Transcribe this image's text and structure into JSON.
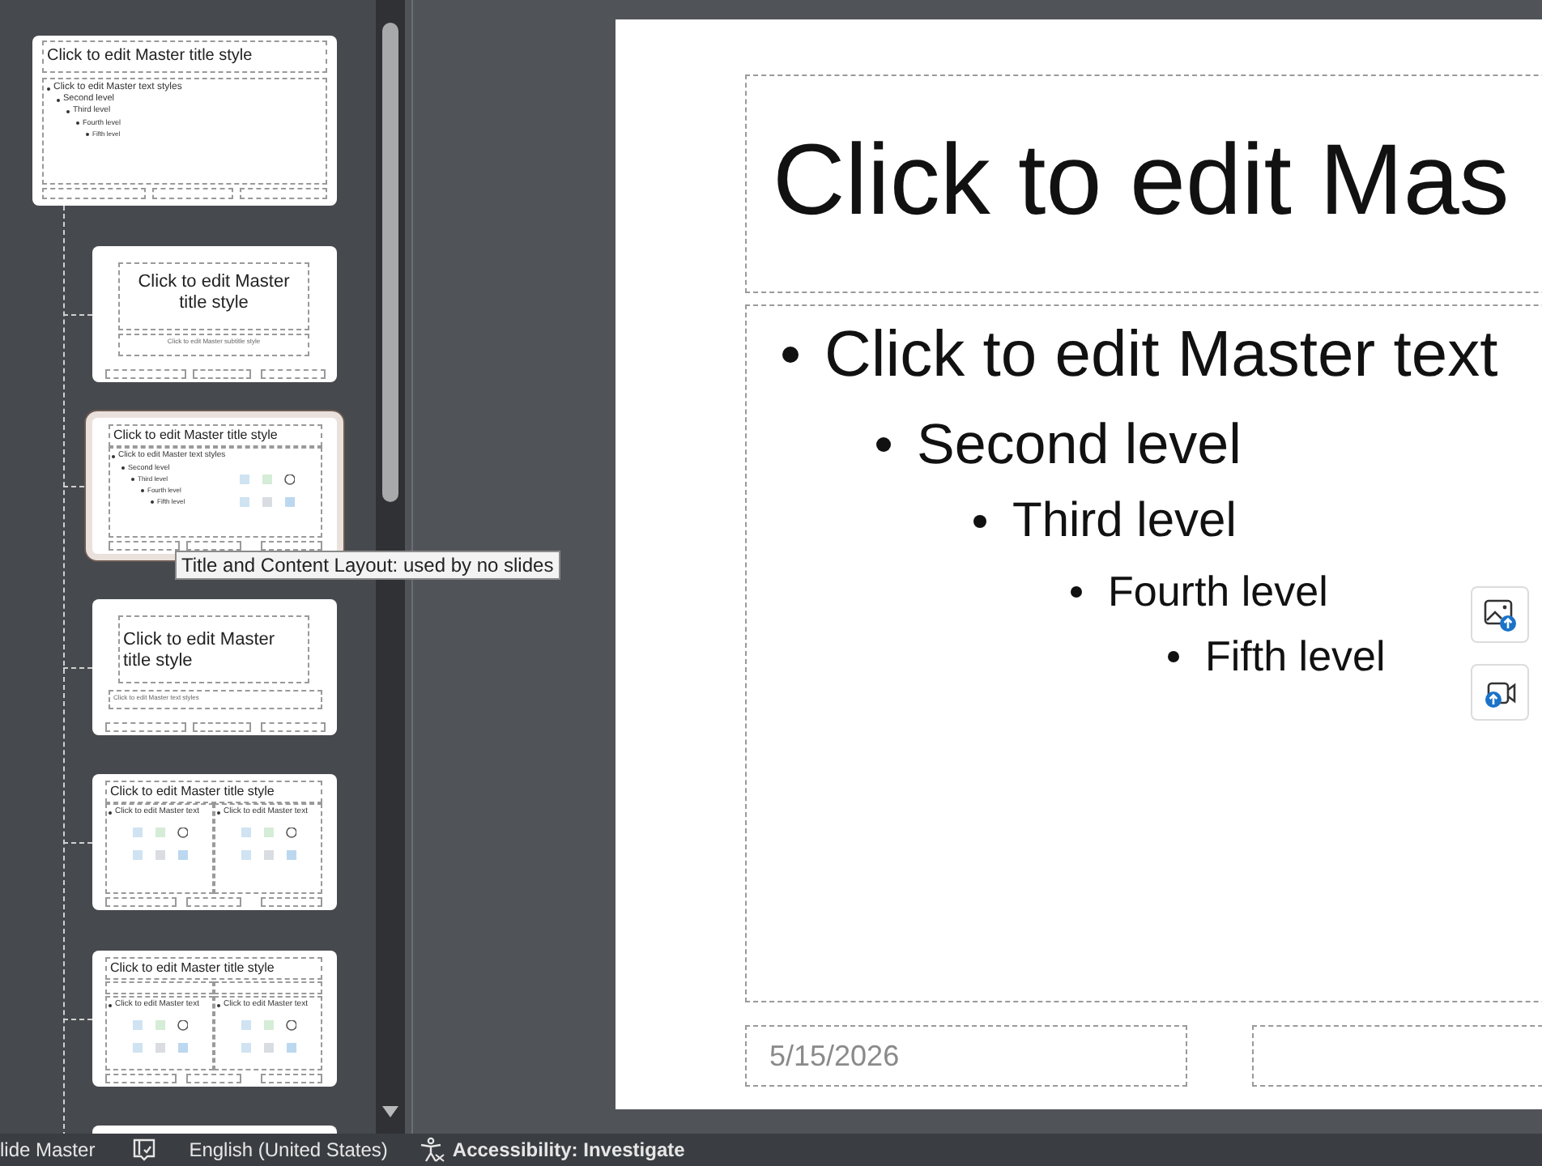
{
  "thumbnails": [
    {
      "kind": "master",
      "selected": false,
      "title": "Click to edit Master title style",
      "levels": [
        "Click to edit Master text styles",
        "Second level",
        "Third level",
        "Fourth level",
        "Fifth level"
      ]
    },
    {
      "kind": "title_slide",
      "selected": false,
      "title": "Click to edit Master title style",
      "subtitle": "Click to edit Master subtitle style"
    },
    {
      "kind": "content",
      "selected": true,
      "title": "Click to edit Master title style",
      "levels": [
        "Click to edit Master text styles",
        "Second level",
        "Third level",
        "Fourth level",
        "Fifth level"
      ]
    },
    {
      "kind": "section",
      "selected": false,
      "title": "Click to edit Master title style",
      "subtitle": "Click to edit Master text styles"
    },
    {
      "kind": "two_content",
      "selected": false,
      "title": "Click to edit Master title style",
      "columns": [
        "Click to edit Master text",
        "Click to edit Master text"
      ]
    },
    {
      "kind": "comparison",
      "selected": false,
      "title": "Click to edit Master title style",
      "columns": [
        "Click to edit Master text",
        "Click to edit Master text"
      ]
    },
    {
      "kind": "partial",
      "selected": false
    }
  ],
  "tooltip": "Title and Content Layout: used by no slides",
  "slide": {
    "title": "Click to edit Mas",
    "levels": [
      "Click to edit Master text",
      "Second level",
      "Third level",
      "Fourth level",
      "Fifth level"
    ],
    "date": "5/15/2026"
  },
  "status_bar": {
    "view": "lide Master",
    "language": "English (United States)",
    "accessibility": "Accessibility: Investigate"
  }
}
